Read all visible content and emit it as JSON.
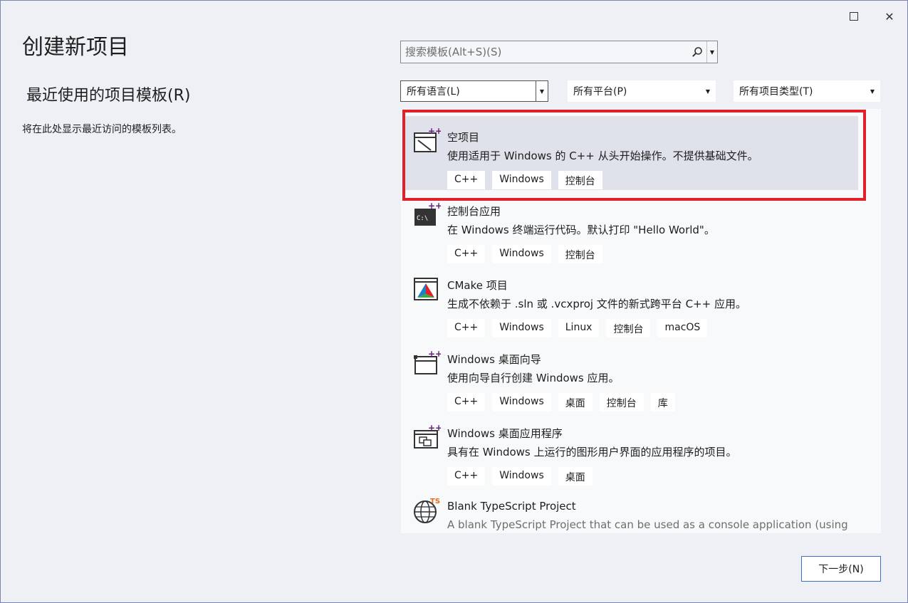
{
  "window": {
    "maximize_label": "",
    "close_label": "✕"
  },
  "page_title": "创建新项目",
  "recent": {
    "title": "最近使用的项目模板(R)",
    "empty_text": "将在此处显示最近访问的模板列表。"
  },
  "search": {
    "placeholder": "搜索模板(Alt+S)(S)",
    "value": ""
  },
  "filters": {
    "language": "所有语言(L)",
    "platform": "所有平台(P)",
    "project_type": "所有项目类型(T)"
  },
  "templates": [
    {
      "icon": "empty-project-icon",
      "title": "空项目",
      "description": "使用适用于 Windows 的 C++ 从头开始操作。不提供基础文件。",
      "tags": [
        "C++",
        "Windows",
        "控制台"
      ],
      "selected": true
    },
    {
      "icon": "console-app-icon",
      "title": "控制台应用",
      "description": "在 Windows 终端运行代码。默认打印 \"Hello World\"。",
      "tags": [
        "C++",
        "Windows",
        "控制台"
      ]
    },
    {
      "icon": "cmake-icon",
      "title": "CMake 项目",
      "description": "生成不依赖于 .sln 或 .vcxproj 文件的新式跨平台 C++ 应用。",
      "tags": [
        "C++",
        "Windows",
        "Linux",
        "控制台",
        "macOS"
      ]
    },
    {
      "icon": "desktop-wizard-icon",
      "title": "Windows 桌面向导",
      "description": "使用向导自行创建 Windows 应用。",
      "tags": [
        "C++",
        "Windows",
        "桌面",
        "控制台",
        "库"
      ]
    },
    {
      "icon": "desktop-app-icon",
      "title": "Windows 桌面应用程序",
      "description": "具有在 Windows 上运行的图形用户界面的应用程序的项目。",
      "tags": [
        "C++",
        "Windows",
        "桌面"
      ]
    },
    {
      "icon": "typescript-globe-icon",
      "title": "Blank TypeScript Project",
      "description": "A blank TypeScript Project that can be used as a console application (using",
      "tags": []
    }
  ],
  "next_button": "下一步(N)",
  "colors": {
    "highlight": "#e3202a",
    "accent": "#3a6fc4",
    "selected_bg": "#dfe2ea"
  }
}
